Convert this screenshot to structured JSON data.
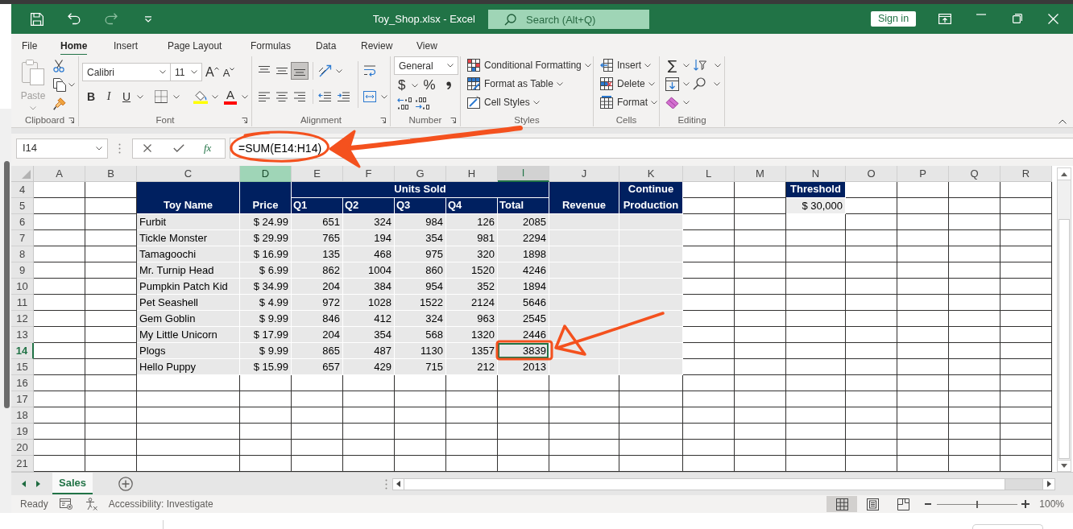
{
  "title_bar": {
    "quick_access": [
      {
        "kind": "save",
        "disabled": false
      },
      {
        "kind": "undo",
        "disabled": false
      },
      {
        "kind": "redo",
        "disabled": true
      },
      {
        "kind": "customize",
        "disabled": false
      }
    ],
    "title": "Toy_Shop.xlsx - Excel",
    "search": {
      "placeholder": "Search (Alt+Q)"
    },
    "sign_in": "Sign in"
  },
  "menu_tabs": [
    {
      "label": "File",
      "selected": false
    },
    {
      "label": "Home",
      "selected": true
    },
    {
      "label": "Insert",
      "selected": false
    },
    {
      "label": "Page Layout",
      "selected": false
    },
    {
      "label": "Formulas",
      "selected": false
    },
    {
      "label": "Data",
      "selected": false
    },
    {
      "label": "Review",
      "selected": false
    },
    {
      "label": "View",
      "selected": false
    }
  ],
  "ribbon": {
    "clipboard": {
      "label": "Clipboard",
      "paste": {
        "label": "Paste",
        "disabled": true
      }
    },
    "font": {
      "label": "Font",
      "font_name": "Calibri",
      "font_size": "11",
      "grow_font": "A",
      "shrink_font": "A",
      "style_buttons": [
        "B",
        "I",
        "U"
      ],
      "font_color": "A"
    },
    "alignment": {
      "label": "Alignment",
      "vertical": [
        {
          "kind": "top",
          "selected": false
        },
        {
          "kind": "middle",
          "selected": false
        },
        {
          "kind": "bottom",
          "selected": true
        }
      ]
    },
    "number": {
      "label": "Number",
      "format": "General",
      "currency": "$",
      "percent": "%"
    },
    "styles": {
      "label": "Styles",
      "commands": [
        "Conditional Formatting",
        "Format as Table",
        "Cell Styles"
      ]
    },
    "cells": {
      "label": "Cells",
      "commands": [
        "Insert",
        "Delete",
        "Format"
      ]
    },
    "editing": {
      "label": "Editing",
      "autosum": "∑"
    }
  },
  "formula_bar": {
    "name_box": "I14",
    "function_button": "fx",
    "formula": "=SUM(E14:H14)"
  },
  "sheet": {
    "columns": [
      {
        "label": "A",
        "selected": false,
        "highlighted": false
      },
      {
        "label": "B",
        "selected": false,
        "highlighted": false
      },
      {
        "label": "C",
        "selected": false,
        "highlighted": false
      },
      {
        "label": "D",
        "selected": false,
        "highlighted": true
      },
      {
        "label": "E",
        "selected": false,
        "highlighted": false
      },
      {
        "label": "F",
        "selected": false,
        "highlighted": false
      },
      {
        "label": "G",
        "selected": false,
        "highlighted": false
      },
      {
        "label": "H",
        "selected": false,
        "highlighted": false
      },
      {
        "label": "I",
        "selected": true,
        "highlighted": false
      },
      {
        "label": "J",
        "selected": false,
        "highlighted": false
      },
      {
        "label": "K",
        "selected": false,
        "highlighted": false
      },
      {
        "label": "L",
        "selected": false,
        "highlighted": false
      },
      {
        "label": "M",
        "selected": false,
        "highlighted": false
      },
      {
        "label": "N",
        "selected": false,
        "highlighted": false
      },
      {
        "label": "O",
        "selected": false,
        "highlighted": false
      },
      {
        "label": "P",
        "selected": false,
        "highlighted": false
      },
      {
        "label": "Q",
        "selected": false,
        "highlighted": false
      },
      {
        "label": "R",
        "selected": false,
        "highlighted": false
      }
    ],
    "rows": [
      {
        "label": "4",
        "selected": false
      },
      {
        "label": "5",
        "selected": false
      },
      {
        "label": "6",
        "selected": false
      },
      {
        "label": "7",
        "selected": false
      },
      {
        "label": "8",
        "selected": false
      },
      {
        "label": "9",
        "selected": false
      },
      {
        "label": "10",
        "selected": false
      },
      {
        "label": "11",
        "selected": false
      },
      {
        "label": "12",
        "selected": false
      },
      {
        "label": "13",
        "selected": false
      },
      {
        "label": "14",
        "selected": true
      },
      {
        "label": "15",
        "selected": false
      },
      {
        "label": "16",
        "selected": false
      },
      {
        "label": "17",
        "selected": false
      },
      {
        "label": "18",
        "selected": false
      },
      {
        "label": "19",
        "selected": false
      },
      {
        "label": "20",
        "selected": false
      },
      {
        "label": "21",
        "selected": false
      }
    ],
    "table": {
      "headers": {
        "toy_name": "Toy Name",
        "price": "Price",
        "units_sold": "Units Sold",
        "quarters": [
          "Q1",
          "Q2",
          "Q3",
          "Q4"
        ],
        "total": "Total",
        "revenue": "Revenue",
        "continue_production": "Continue Production"
      },
      "rows": [
        {
          "toy_name": "Furbit",
          "price": "$ 24.99",
          "units": [
            "651",
            "324",
            "984",
            "126"
          ],
          "total": "2085"
        },
        {
          "toy_name": "Tickle Monster",
          "price": "$ 29.99",
          "units": [
            "765",
            "194",
            "354",
            "981"
          ],
          "total": "2294"
        },
        {
          "toy_name": "Tamagoochi",
          "price": "$ 16.99",
          "units": [
            "135",
            "468",
            "975",
            "320"
          ],
          "total": "1898"
        },
        {
          "toy_name": "Mr. Turnip Head",
          "price": "$ 6.99",
          "units": [
            "862",
            "1004",
            "860",
            "1520"
          ],
          "total": "4246"
        },
        {
          "toy_name": "Pumpkin Patch Kid",
          "price": "$ 34.99",
          "units": [
            "204",
            "384",
            "954",
            "352"
          ],
          "total": "1894"
        },
        {
          "toy_name": "Pet Seashell",
          "price": "$ 4.99",
          "units": [
            "972",
            "1028",
            "1522",
            "2124"
          ],
          "total": "5646"
        },
        {
          "toy_name": "Gem Goblin",
          "price": "$ 9.99",
          "units": [
            "846",
            "412",
            "324",
            "963"
          ],
          "total": "2545"
        },
        {
          "toy_name": "My Little Unicorn",
          "price": "$ 17.99",
          "units": [
            "204",
            "354",
            "568",
            "1320"
          ],
          "total": "2446"
        },
        {
          "toy_name": "Plogs",
          "price": "$ 9.99",
          "units": [
            "865",
            "487",
            "1130",
            "1357"
          ],
          "total": "3839"
        },
        {
          "toy_name": "Hello Puppy",
          "price": "$ 15.99",
          "units": [
            "657",
            "429",
            "715",
            "212"
          ],
          "total": "2013"
        }
      ]
    },
    "threshold": {
      "label": "Threshold",
      "value": "$ 30,000"
    }
  },
  "sheet_tabs": [
    {
      "label": "Sales",
      "selected": true
    }
  ],
  "status_bar": {
    "status": "Ready",
    "accessibility": "Accessibility: Investigate",
    "views": [
      {
        "kind": "normal",
        "selected": true
      },
      {
        "kind": "page_layout",
        "selected": false
      },
      {
        "kind": "page_break",
        "selected": false
      }
    ],
    "zoom_slider": {
      "level": 0.5
    },
    "zoom": "100%"
  }
}
